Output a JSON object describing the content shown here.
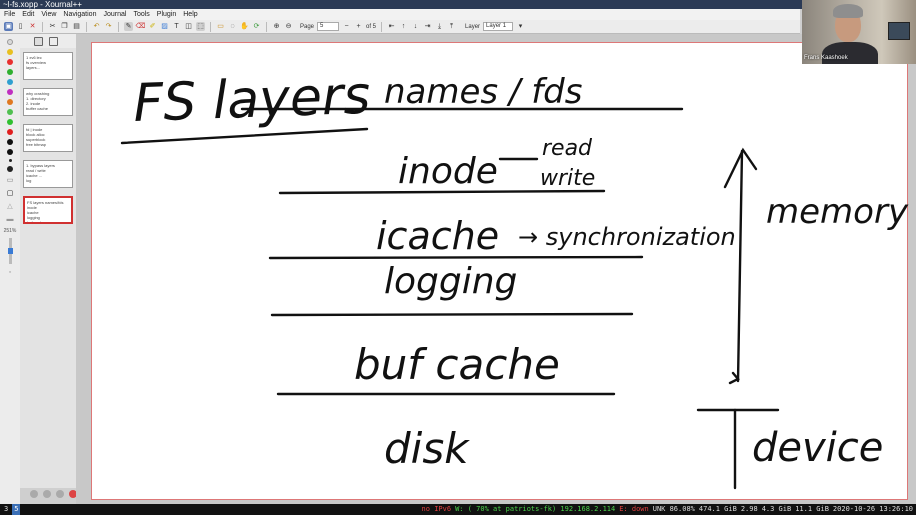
{
  "window": {
    "title": "~l-fs.xopp - Xournal++"
  },
  "menu": [
    "File",
    "Edit",
    "View",
    "Navigation",
    "Journal",
    "Tools",
    "Plugin",
    "Help"
  ],
  "toolbar": {
    "page_label": "Page",
    "page_value": "5",
    "of_pages": "of 5",
    "layer_label": "Layer",
    "layer_value": "Layer 1"
  },
  "palette": {
    "colors": [
      "#d9d9d9",
      "#e8c020",
      "#e83030",
      "#30b030",
      "#30a0d0",
      "#c030c0",
      "#e07820",
      "#50c050",
      "#30c030",
      "#e02020",
      "#111111",
      "#111111"
    ],
    "zoom": "251%"
  },
  "thumbnails": [
    {
      "text": "1 xv6 lec\nfs overview\nlayers...",
      "selected": false
    },
    {
      "text": "why crashing\n1. directory\n2. inode\nbuffer cache",
      "selected": false
    },
    {
      "text": "fd | inode\nblock alloc\nsuperblock\nfree bitmap",
      "selected": false
    },
    {
      "text": "1. bypass layers\nread / write\nicache ...\nlog",
      "selected": false
    },
    {
      "text": "FS layers names/fds\ninode\nicache\nlogging\nbuf cache\ndisk",
      "selected": true
    }
  ],
  "note": {
    "title": "FS layers",
    "top": "names / fds",
    "inode": "inode",
    "rw1": "read",
    "rw2": "write",
    "icache": "icache",
    "sync": "→ synchronization",
    "logging": "logging",
    "buf": "buf cache",
    "disk": "disk",
    "memory": "memory",
    "device": "device"
  },
  "webcam": {
    "name": "Frans Kaashoek"
  },
  "statusbar": {
    "workspaces": [
      "3",
      "5"
    ],
    "active_ws": "5",
    "ipv6": "no IPv6",
    "wifi": "W: ( 70% at patriots-fk) 192.168.2.114",
    "eth": "E: down",
    "bat": "UNK 86.08%",
    "disk": "474.1 GiB",
    "load": "2.98",
    "mem1": "4.3 GiB",
    "mem2": "11.1 GiB",
    "clock": "2020-10-26 13:26:10"
  }
}
